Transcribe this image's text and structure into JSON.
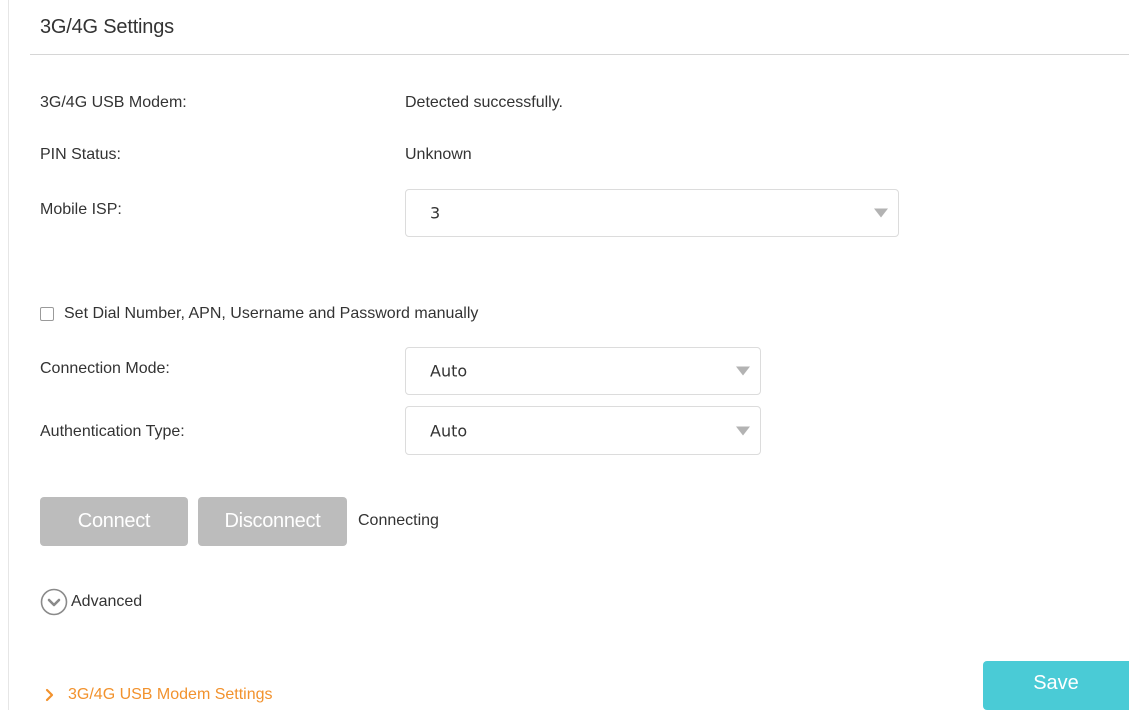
{
  "section": {
    "title": "3G/4G Settings"
  },
  "modem": {
    "label": "3G/4G USB Modem:",
    "value": "Detected successfully."
  },
  "pin": {
    "label": "PIN Status:",
    "value": "Unknown"
  },
  "isp": {
    "label": "Mobile ISP:",
    "selected": "3"
  },
  "manual_checkbox": {
    "label": "Set Dial Number, APN, Username and Password manually",
    "checked": false
  },
  "connection_mode": {
    "label": "Connection Mode:",
    "selected": "Auto"
  },
  "auth_type": {
    "label": "Authentication Type:",
    "selected": "Auto"
  },
  "actions": {
    "connect_label": "Connect",
    "disconnect_label": "Disconnect",
    "status": "Connecting"
  },
  "advanced": {
    "label": "Advanced",
    "icon": "chevron-down-circle-icon"
  },
  "footer": {
    "link_label": "3G/4G USB Modem Settings",
    "link_icon": "chevron-right-icon",
    "save_label": "Save"
  },
  "colors": {
    "accent_orange": "#f2922d",
    "save_teal": "#4acbd6",
    "button_gray": "#bcbcbc",
    "text": "#333333"
  }
}
